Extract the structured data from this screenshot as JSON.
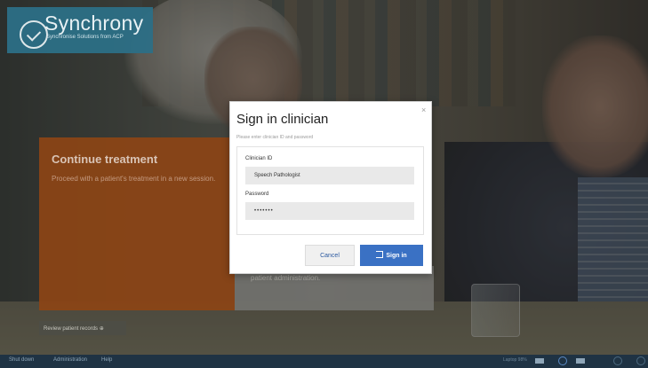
{
  "branding": {
    "name": "Synchrony",
    "tagline": "Synchronise Solutions from ACP"
  },
  "tiles": {
    "continue_treatment": {
      "title": "Continue treatment",
      "description": "Proceed with a patient's treatment in a new session."
    },
    "administration": {
      "text": "patient administration."
    }
  },
  "review_button": {
    "label": "Review patient records ⊕"
  },
  "bottom_bar": {
    "links": [
      "Shut down",
      "Administration",
      "Help"
    ],
    "status_text": "Laptop  98%",
    "icons": [
      "battery-icon",
      "power-icon",
      "wifi-icon",
      "settings-icon"
    ]
  },
  "dialog": {
    "title": "Sign in clinician",
    "subtitle": "Please enter clinician ID and password",
    "close_label": "×",
    "clinician_id": {
      "label": "Clinician ID",
      "value": "Speech Pathologist"
    },
    "password": {
      "label": "Password",
      "value": "•••••••"
    },
    "cancel_label": "Cancel",
    "signin_label": "Sign in"
  },
  "colors": {
    "accent": "#3a71c4",
    "tile_orange": "#8a4416",
    "logo_teal": "#2c6f86",
    "bottom_bar": "#1f3344"
  }
}
